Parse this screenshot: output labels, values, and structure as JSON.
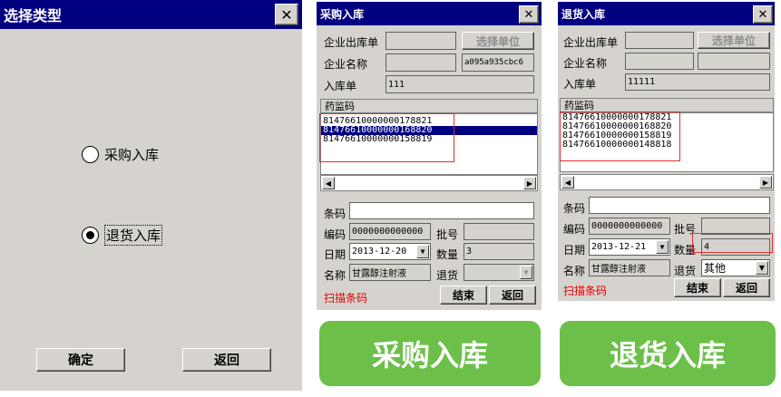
{
  "dialog1": {
    "title": "选择类型",
    "close": "✕",
    "radio_purchase": "采购入库",
    "radio_return": "退货入库",
    "selected": "return",
    "ok_button": "确定",
    "back_button": "返回"
  },
  "dialog2": {
    "title": "采购入库",
    "close": "✕",
    "label_outbound": "企业出库单",
    "outbound_value": "",
    "select_unit_button": "选择单位",
    "label_company": "企业名称",
    "company_value": "",
    "company_code": "a095a935cbc6",
    "label_inbound": "入库单",
    "inbound_value": "111",
    "list_header": "药监码",
    "list_rows": [
      "81476610000000178821",
      "81476610000000168820",
      "81476610000000158819"
    ],
    "selected_row": 1,
    "label_barcode": "条码",
    "barcode_value": "",
    "label_code": "编码",
    "code_value": "0000000000000",
    "label_batch": "批号",
    "batch_value": "",
    "label_date": "日期",
    "date_value": "2013-12-20",
    "label_qty": "数量",
    "qty_value": "3",
    "label_name": "名称",
    "name_value": "甘露醇注射液",
    "label_return": "退货",
    "return_value": "",
    "scan_text": "扫描条码",
    "finish_button": "结束",
    "back_button": "返回",
    "banner": "采购入库"
  },
  "dialog3": {
    "title": "退货入库",
    "close": "✕",
    "label_outbound": "企业出库单",
    "outbound_value": "",
    "select_unit_button": "选择单位",
    "label_company": "企业名称",
    "company_value": "",
    "company_code": "",
    "label_inbound": "入库单",
    "inbound_value": "11111",
    "list_header": "药监码",
    "list_rows": [
      "81476610000000178821",
      "81476610000000168820",
      "81476610000000158819",
      "81476610000000148818"
    ],
    "label_barcode": "条码",
    "barcode_value": "",
    "label_code": "编码",
    "code_value": "0000000000000",
    "label_batch": "批号",
    "batch_value": "",
    "label_date": "日期",
    "date_value": "2013-12-21",
    "label_qty": "数量",
    "qty_value": "4",
    "label_name": "名称",
    "name_value": "甘露醇注射液",
    "label_return": "退货",
    "return_value": "其他",
    "scan_text": "扫描条码",
    "finish_button": "结束",
    "back_button": "返回",
    "banner": "退货入库"
  },
  "colors": {
    "title_bar": "#000080",
    "window_bg": "#d6d3ce",
    "banner_green": "#6cc04a",
    "scan_red": "#e00000",
    "highlight_red": "#e03030"
  }
}
